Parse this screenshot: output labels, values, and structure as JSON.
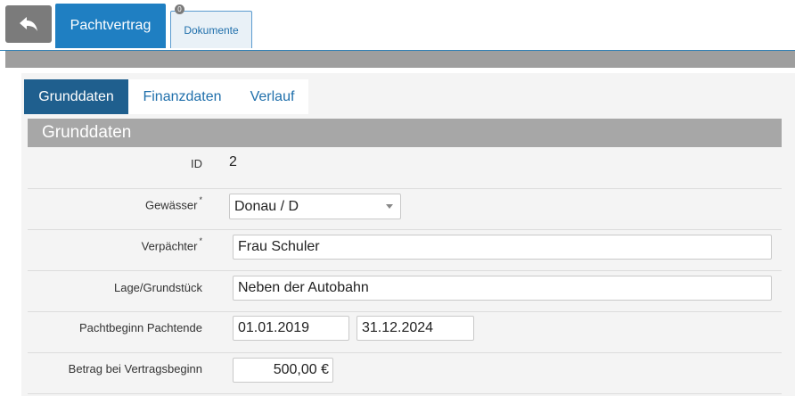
{
  "toolbar": {
    "back_icon": "reply-arrow-icon",
    "main_tab": "Pachtvertrag",
    "docs_tab": "Dokumente",
    "docs_count": "0"
  },
  "subtabs": [
    "Grunddaten",
    "Finanzdaten",
    "Verlauf"
  ],
  "section": {
    "title": "Grunddaten"
  },
  "form": {
    "id_label": "ID",
    "id_value": "2",
    "gewaesser_label": "Gewässer",
    "gewaesser_value": "Donau / D",
    "verpaechter_label": "Verpächter",
    "verpaechter_value": "Frau Schuler",
    "lage_label": "Lage/Grundstück",
    "lage_value": "Neben der Autobahn",
    "pacht_label": "Pachtbeginn Pachtende",
    "pachtbeginn_value": "01.01.2019",
    "pachtende_value": "31.12.2024",
    "betrag_label": "Betrag bei Vertragsbeginn",
    "betrag_value": "500,00 €",
    "required_mark": "*"
  },
  "colors": {
    "primary_blue": "#1f7fc2",
    "active_subtab": "#1f5f8e",
    "link_blue": "#1f6fab",
    "header_gray": "#a7a7a7"
  }
}
